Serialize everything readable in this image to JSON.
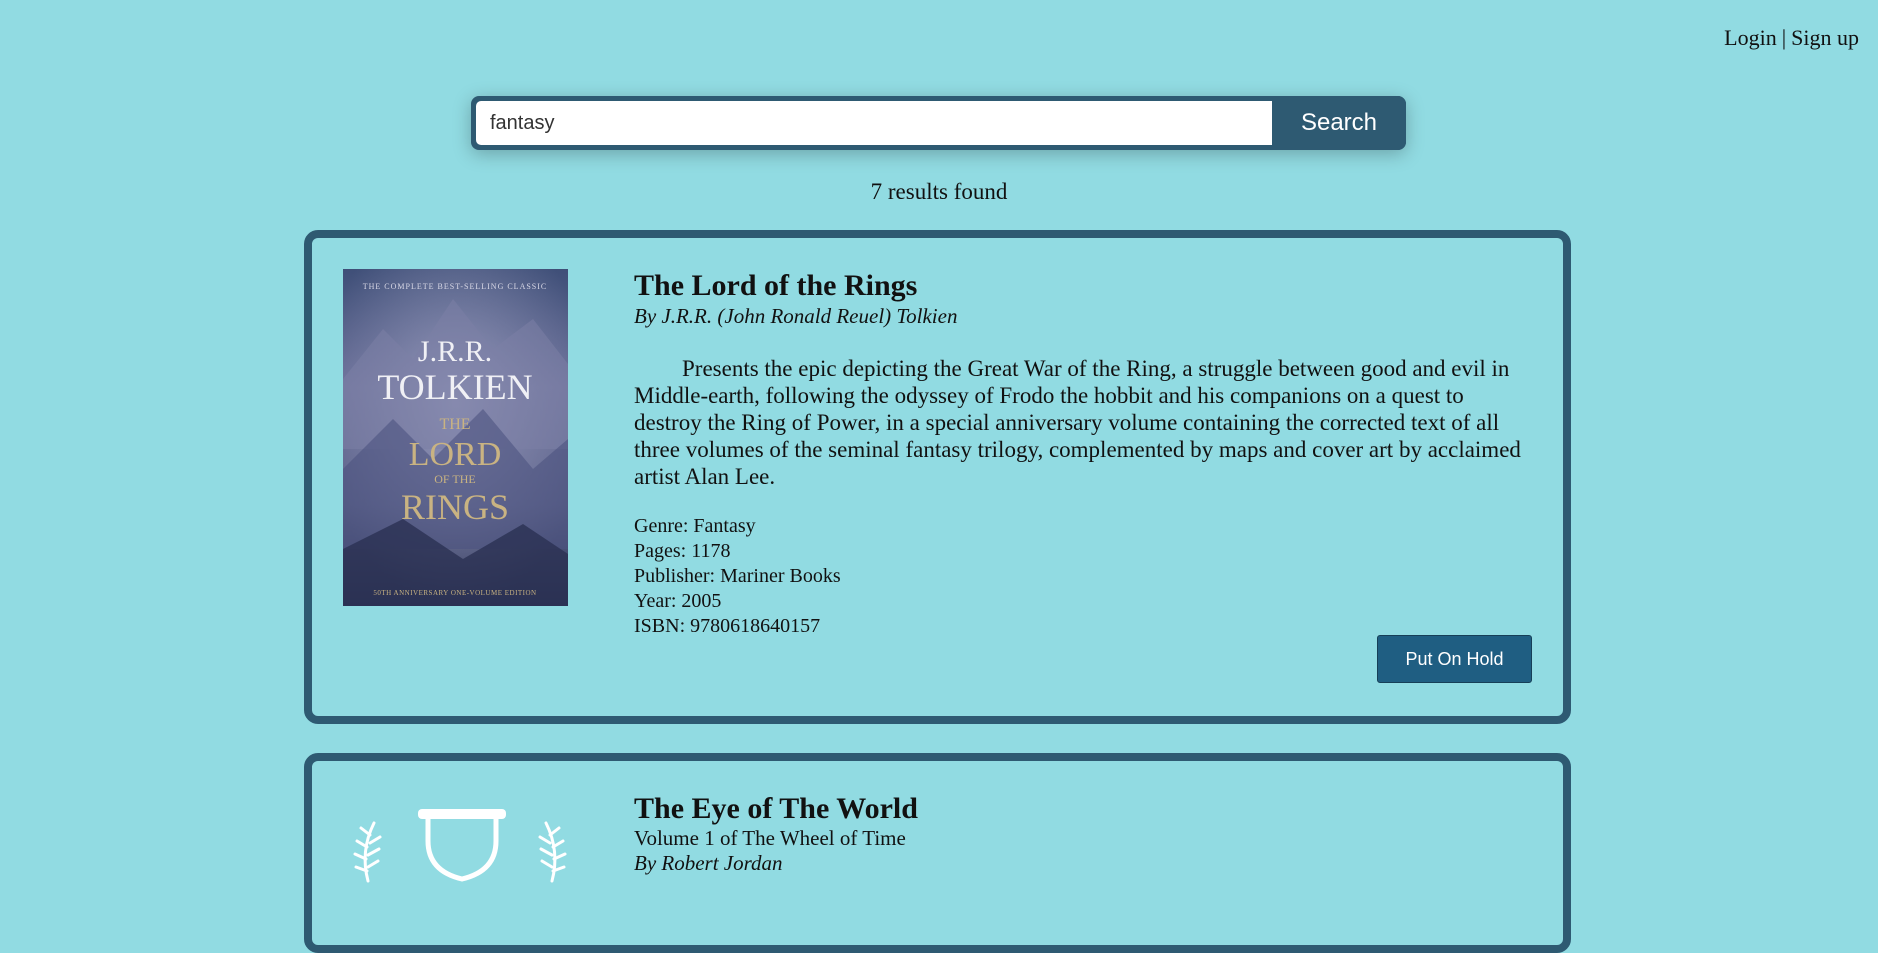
{
  "auth": {
    "login": "Login",
    "separator": "|",
    "signup": "Sign up"
  },
  "search": {
    "value": "fantasy",
    "button_label": "Search"
  },
  "results": {
    "count_text": "7 results found"
  },
  "books": [
    {
      "title": "The Lord of the Rings",
      "author_line": "By J.R.R. (John Ronald Reuel) Tolkien",
      "description": "Presents the epic depicting the Great War of the Ring, a struggle between good and evil in Middle-earth, following the odyssey of Frodo the hobbit and his companions on a quest to destroy the Ring of Power, in a special anniversary volume containing the corrected text of all three volumes of the seminal fantasy trilogy, complemented by maps and cover art by acclaimed artist Alan Lee.",
      "genre": "Genre: Fantasy",
      "pages": "Pages: 1178",
      "publisher": "Publisher: Mariner Books",
      "year": "Year: 2005",
      "isbn": "ISBN: 9780618640157",
      "hold_label": "Put On Hold",
      "cover": {
        "top_text": "THE COMPLETE BEST-SELLING CLASSIC",
        "author_line1": "J.R.R.",
        "author_line2": "TOLKIEN",
        "title_line1": "THE",
        "title_line2": "LORD",
        "title_line3": "OF THE",
        "title_line4": "RINGS",
        "bottom_text": "50TH ANNIVERSARY ONE-VOLUME EDITION"
      }
    },
    {
      "title": "The Eye of The World",
      "series_line": "Volume 1 of The Wheel of Time",
      "author_line": "By Robert Jordan"
    }
  ],
  "colors": {
    "background": "#91dbe2",
    "accent": "#2e5a72",
    "button": "#1f5e82"
  }
}
